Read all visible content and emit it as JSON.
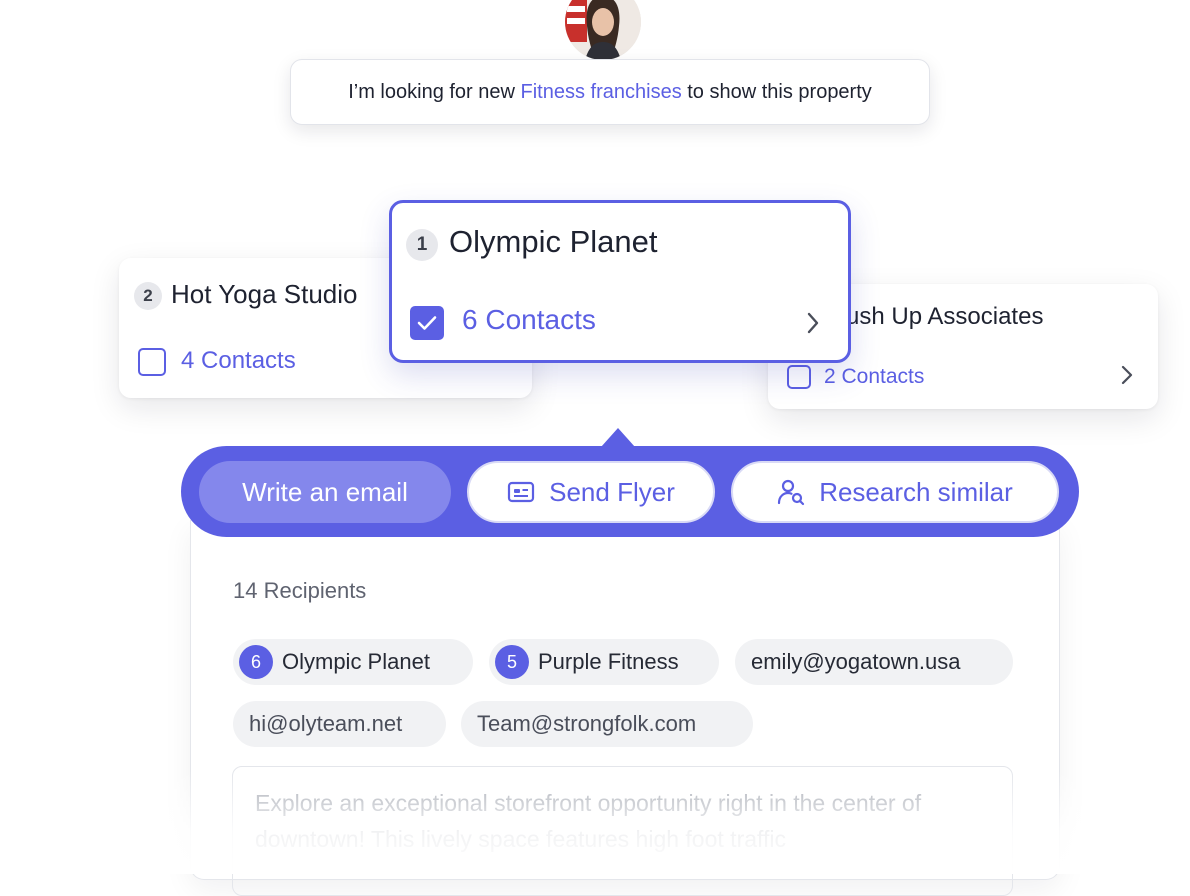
{
  "prompt": {
    "before": "I’m looking for new ",
    "highlight": "Fitness franchises",
    "after": " to show this property"
  },
  "cards": {
    "main": {
      "rank": "1",
      "title": "Olympic Planet",
      "contacts": "6 Contacts",
      "checked": true
    },
    "left": {
      "rank": "2",
      "title": "Hot Yoga Studio",
      "contacts": "4 Contacts",
      "checked": false
    },
    "right": {
      "title": "ush Up Associates",
      "contacts": "2 Contacts",
      "checked": false
    }
  },
  "actions": {
    "write_email": "Write an email",
    "send_flyer": "Send Flyer",
    "research_similar": "Research similar"
  },
  "email": {
    "recipients_label": "14 Recipients",
    "chips": [
      {
        "count": "6",
        "label": "Olympic Planet"
      },
      {
        "count": "5",
        "label": "Purple Fitness"
      },
      {
        "label": "emily@yogatown.usa"
      },
      {
        "label": "hi@olyteam.net"
      },
      {
        "label": "Team@strongfolk.com"
      }
    ],
    "body_text": "Explore an exceptional storefront opportunity right in the center of downtown! This lively space features high foot traffic"
  },
  "colors": {
    "accent": "#5b5fe3",
    "accent_light": "#8487ec"
  },
  "icons": [
    "avatar",
    "checkbox-checked-icon",
    "checkbox-icon",
    "chevron-right-icon",
    "flyer-card-icon",
    "user-search-icon"
  ]
}
